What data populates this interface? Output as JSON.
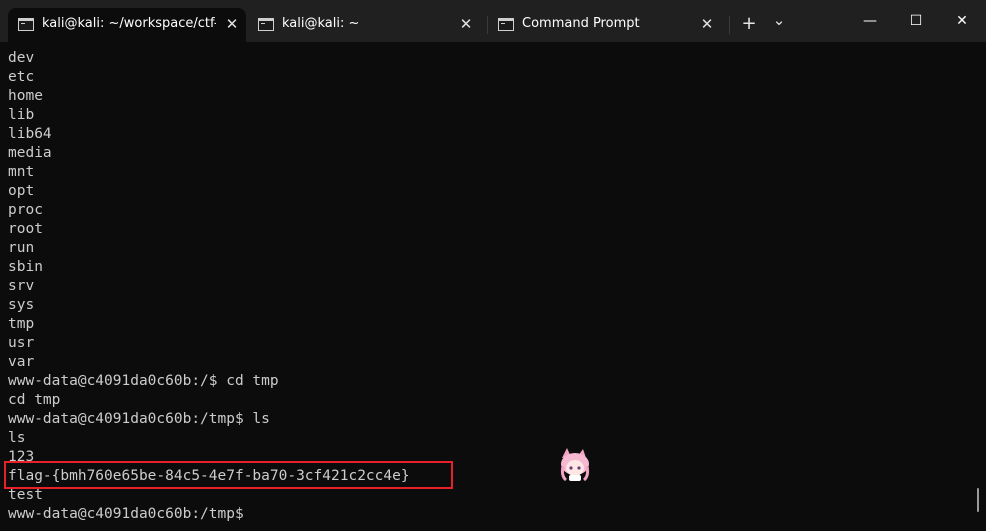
{
  "tabs": [
    {
      "title": "kali@kali: ~/workspace/ctf-ga",
      "active": true,
      "icon": "terminal-icon"
    },
    {
      "title": "kali@kali: ~",
      "active": false,
      "icon": "terminal-icon"
    },
    {
      "title": "Command Prompt",
      "active": false,
      "icon": "terminal-icon"
    }
  ],
  "tab_close_glyph": "✕",
  "toolbar": {
    "new_tab_glyph": "+",
    "dropdown_glyph": "⌄"
  },
  "window_controls": {
    "minimize_glyph": "—",
    "maximize_glyph": "☐",
    "close_glyph": "✕"
  },
  "terminal": {
    "lines": [
      "dev",
      "etc",
      "home",
      "lib",
      "lib64",
      "media",
      "mnt",
      "opt",
      "proc",
      "root",
      "run",
      "sbin",
      "srv",
      "sys",
      "tmp",
      "usr",
      "var",
      "www-data@c4091da0c60b:/$ cd tmp",
      "cd tmp",
      "www-data@c4091da0c60b:/tmp$ ls",
      "ls",
      "123",
      "flag-{bmh760e65be-84c5-4e7f-ba70-3cf421c2cc4e}",
      "test",
      "www-data@c4091da0c60b:/tmp$"
    ],
    "highlighted_line": "flag-{bmh760e65be-84c5-4e7f-ba70-3cf421c2cc4e}",
    "highlight_color": "#e8202a",
    "text_color": "#cccccc",
    "background_color": "#0c0c0c"
  },
  "colors": {
    "tabbar_bg": "#202020",
    "active_tab_bg": "#0c0c0c"
  }
}
